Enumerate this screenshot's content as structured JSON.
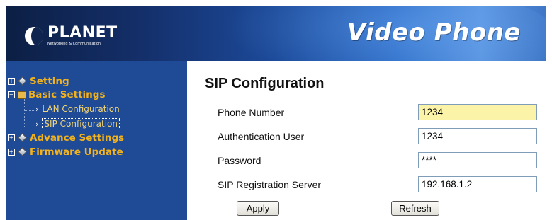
{
  "header": {
    "brand_name": "PLANET",
    "brand_tagline": "Networking & Communication",
    "product_title": "Video Phone"
  },
  "sidebar": {
    "items": [
      {
        "label": "Setting",
        "expander": "+"
      },
      {
        "label": "Basic Settings",
        "expander": "−",
        "children": [
          {
            "label": "LAN Configuration"
          },
          {
            "label": "SIP Configuration",
            "selected": true
          }
        ]
      },
      {
        "label": "Advance Settings",
        "expander": "+"
      },
      {
        "label": "Firmware Update",
        "expander": "+"
      }
    ]
  },
  "main": {
    "title": "SIP Configuration",
    "fields": [
      {
        "label": "Phone Number",
        "value": "1234"
      },
      {
        "label": "Authentication User",
        "value": "1234"
      },
      {
        "label": "Password",
        "value": "****"
      },
      {
        "label": "SIP Registration Server",
        "value": "192.168.1.2"
      }
    ],
    "apply_label": "Apply",
    "refresh_label": "Refresh"
  },
  "colors": {
    "sidebar_bg": "#1f4a95",
    "menu_text": "#f2b21c",
    "highlight_input": "#fbf3a8"
  }
}
